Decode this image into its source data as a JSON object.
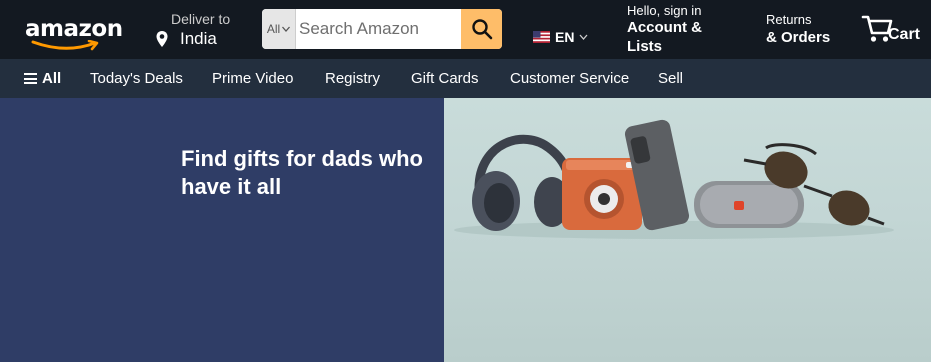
{
  "header": {
    "logo_text": "amazon",
    "deliver_line1": "Deliver to",
    "deliver_line2": "India",
    "search_category": "All",
    "search_placeholder": "Search Amazon",
    "language": "EN",
    "account_line1": "Hello, sign in",
    "account_line2": "Account & Lists",
    "orders_line1": "Returns",
    "orders_line2": "& Orders",
    "cart_label": "Cart",
    "icons": [
      "location-pin-icon",
      "chevron-down-icon",
      "search-icon",
      "us-flag-icon",
      "cart-icon"
    ]
  },
  "subnav": {
    "all_label": "All",
    "items": [
      "Today's Deals",
      "Prime Video",
      "Registry",
      "Gift Cards",
      "Customer Service",
      "Sell"
    ]
  },
  "hero": {
    "title": "Find gifts for dads who have it all"
  },
  "colors": {
    "topbar": "#131921",
    "subnav": "#232f3e",
    "search_button": "#febd69",
    "hero_left": "#2f3d66",
    "hero_right": "#c3d6d5",
    "logo_smile": "#ff9900"
  }
}
